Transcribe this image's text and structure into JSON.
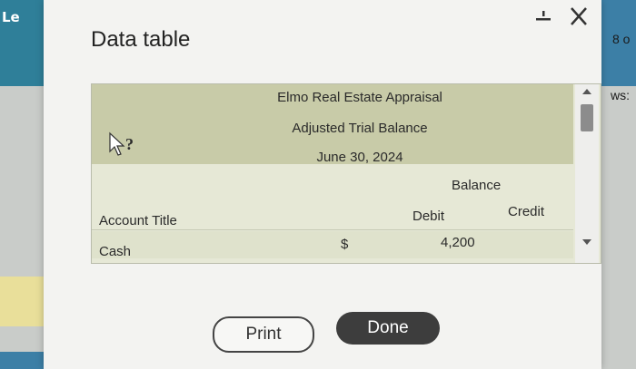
{
  "background": {
    "left_logo_text": "Le",
    "right_text_1": "8 o",
    "right_text_2": "ws:"
  },
  "dialog": {
    "title": "Data table",
    "controls": {
      "minimize": "minimize-icon",
      "close": "close-icon"
    }
  },
  "table": {
    "company": "Elmo Real Estate Appraisal",
    "report": "Adjusted Trial Balance",
    "date": "June 30, 2024",
    "balance_header": "Balance",
    "columns": {
      "account": "Account Title",
      "debit": "Debit",
      "credit": "Credit"
    },
    "rows": [
      {
        "account": "Cash",
        "currency": "$",
        "debit": "4,200",
        "credit": ""
      }
    ]
  },
  "buttons": {
    "print": "Print",
    "done": "Done"
  },
  "colors": {
    "header_band": "#c8cba8",
    "panel": "#e6e8d6",
    "done_button": "#3d3d3d",
    "dialog_bg": "#f3f3f1"
  }
}
